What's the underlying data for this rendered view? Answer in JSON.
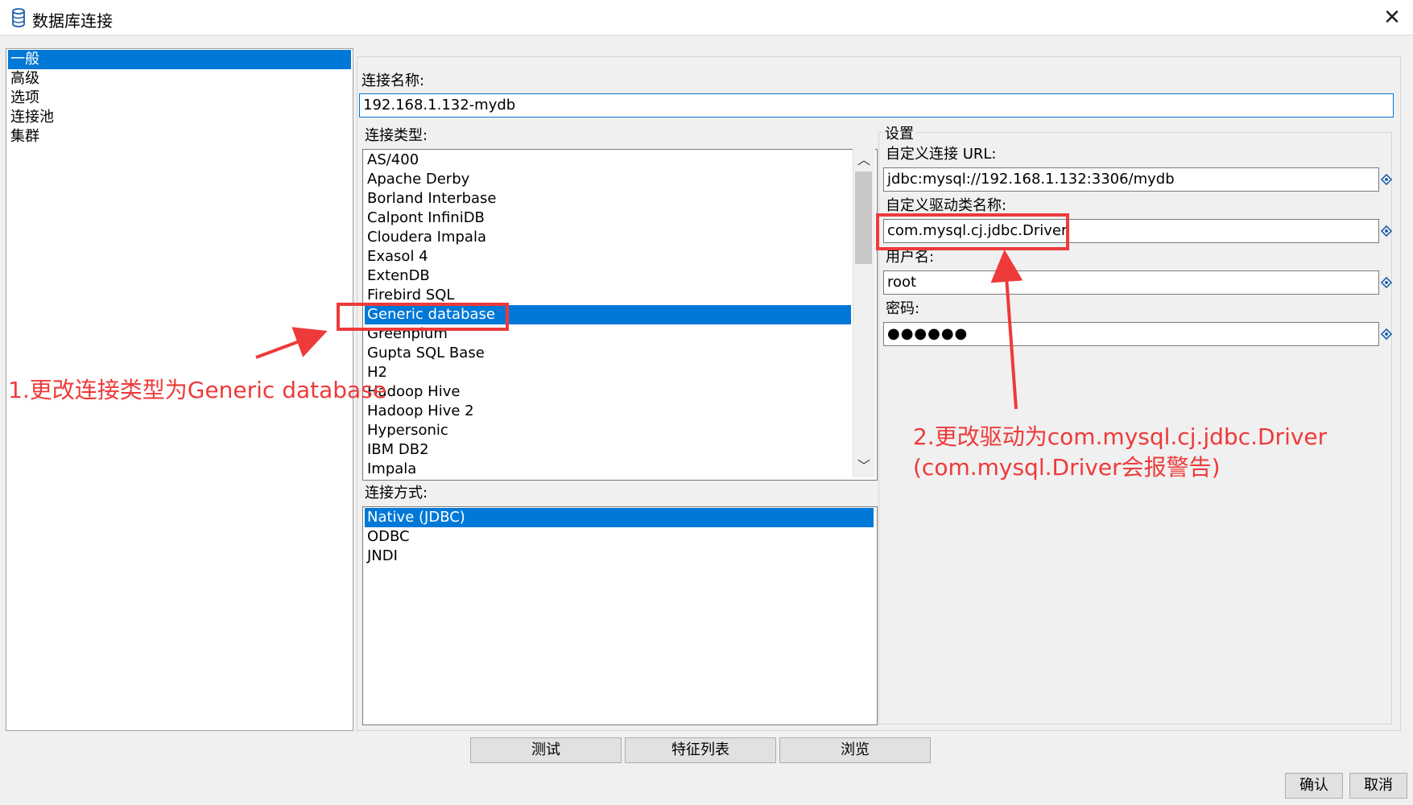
{
  "window": {
    "title": "数据库连接",
    "close_label": "✕"
  },
  "nav": {
    "items": [
      "一般",
      "高级",
      "选项",
      "连接池",
      "集群"
    ],
    "selected_index": 0
  },
  "form": {
    "conn_name_label": "连接名称:",
    "conn_name_value": "192.168.1.132-mydb",
    "conn_type_label": "连接类型:",
    "conn_types": [
      "AS/400",
      "Apache Derby",
      "Borland Interbase",
      "Calpont InfiniDB",
      "Cloudera Impala",
      "Exasol 4",
      "ExtenDB",
      "Firebird SQL",
      "Generic database",
      "Greenplum",
      "Gupta SQL Base",
      "H2",
      "Hadoop Hive",
      "Hadoop Hive 2",
      "Hypersonic",
      "IBM DB2",
      "Impala"
    ],
    "conn_type_selected": "Generic database",
    "access_label": "连接方式:",
    "access_methods": [
      "Native (JDBC)",
      "ODBC",
      "JNDI"
    ],
    "access_selected": "Native (JDBC)"
  },
  "settings": {
    "title": "设置",
    "url_label": "自定义连接 URL:",
    "url_value": "jdbc:mysql://192.168.1.132:3306/mydb",
    "driver_label": "自定义驱动类名称:",
    "driver_value": "com.mysql.cj.jdbc.Driver",
    "user_label": "用户名:",
    "user_value": "root",
    "password_label": "密码:",
    "password_value": "●●●●●●"
  },
  "buttons": {
    "test": "测试",
    "features": "特征列表",
    "browse": "浏览",
    "ok": "确认",
    "cancel": "取消"
  },
  "annotations": {
    "note1": "1.更改连接类型为Generic database",
    "note2_line1": "2.更改驱动为com.mysql.cj.jdbc.Driver",
    "note2_line2": "(com.mysql.Driver会报警告)",
    "color": "#ee3a3a"
  },
  "colors": {
    "selection": "#0078d7",
    "annotation": "#ee3a3a"
  }
}
